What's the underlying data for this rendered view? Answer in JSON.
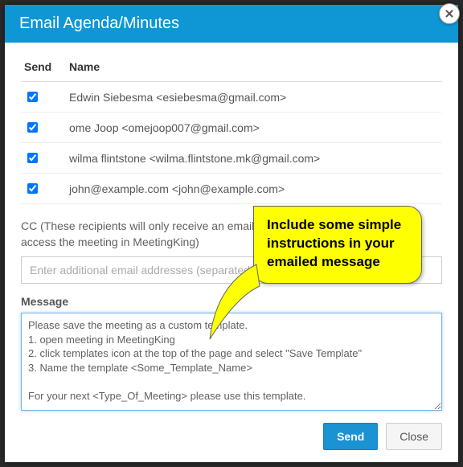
{
  "header": {
    "title": "Email Agenda/Minutes"
  },
  "table": {
    "headers": {
      "send": "Send",
      "name": "Name"
    },
    "rows": [
      {
        "name": "Edwin Siebesma <esiebesma@gmail.com>"
      },
      {
        "name": "ome Joop <omejoop007@gmail.com>"
      },
      {
        "name": "wilma flintstone <wilma.flintstone.mk@gmail.com>"
      },
      {
        "name": "john@example.com <john@example.com>"
      }
    ]
  },
  "cc": {
    "label": "CC (These recipients will only receive an email with the agenda. They cannot access the meeting in MeetingKing)",
    "placeholder": "Enter additional email addresses (separated by comma)"
  },
  "message": {
    "label": "Message",
    "value": "Please save the meeting as a custom template.\n1. open meeting in MeetingKing\n2. click templates icon at the top of the page and select \"Save Template\"\n3. Name the template <Some_Template_Name>\n\nFor your next <Type_Of_Meeting> please use this template."
  },
  "footer": {
    "send": "Send",
    "close": "Close"
  },
  "callout": {
    "text": "Include some simple instructions in your emailed message"
  }
}
